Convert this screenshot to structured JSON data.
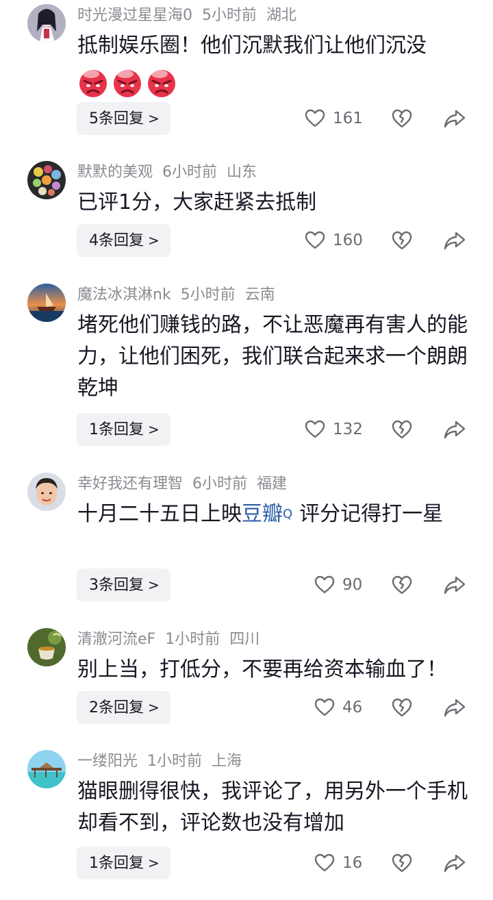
{
  "comments": [
    {
      "username": "时光漫过星星海0",
      "time": "5小时前",
      "location": "湖北",
      "text": "抵制娱乐圈！他们沉默我们让他们沉没",
      "emojis": [
        "angry-face",
        "angry-face",
        "angry-face"
      ],
      "reply_label": "5条回复",
      "likes": "161"
    },
    {
      "username": "默默的美观",
      "time": "6小时前",
      "location": "山东",
      "text": "已评1分，大家赶紧去抵制",
      "reply_label": "4条回复",
      "likes": "160"
    },
    {
      "username": "魔法冰淇淋nk",
      "time": "5小时前",
      "location": "云南",
      "text": "堵死他们赚钱的路，不让恶魔再有害人的能力，让他们困死，我们联合起来求一个朗朗乾坤",
      "reply_label": "1条回复",
      "likes": "132"
    },
    {
      "username": "幸好我还有理智",
      "time": "6小时前",
      "location": "福建",
      "text_before": "十月二十五日上映",
      "text_link": "豆瓣",
      "text_after": "评分记得打一星",
      "reply_label": "3条回复",
      "likes": "90"
    },
    {
      "username": "清澈河流eF",
      "time": "1小时前",
      "location": "四川",
      "text": "别上当，打低分，不要再给资本输血了！",
      "reply_label": "2条回复",
      "likes": "46"
    },
    {
      "username": "一缕阳光",
      "time": "1小时前",
      "location": "上海",
      "text": "猫眼删得很快，我评论了，用另外一个手机却看不到，评论数也没有增加",
      "reply_label": "1条回复",
      "likes": "16"
    }
  ],
  "colors": {
    "meta_gray": "#8a8b91",
    "text_dark": "#161823",
    "link_blue": "#2b5da8",
    "reply_bg": "#f2f2f4"
  },
  "icons": {
    "reply_chevron": ">",
    "search_mark": "Q",
    "like": "heart-icon",
    "dislike": "broken-heart-icon",
    "share": "share-arrow-icon"
  }
}
